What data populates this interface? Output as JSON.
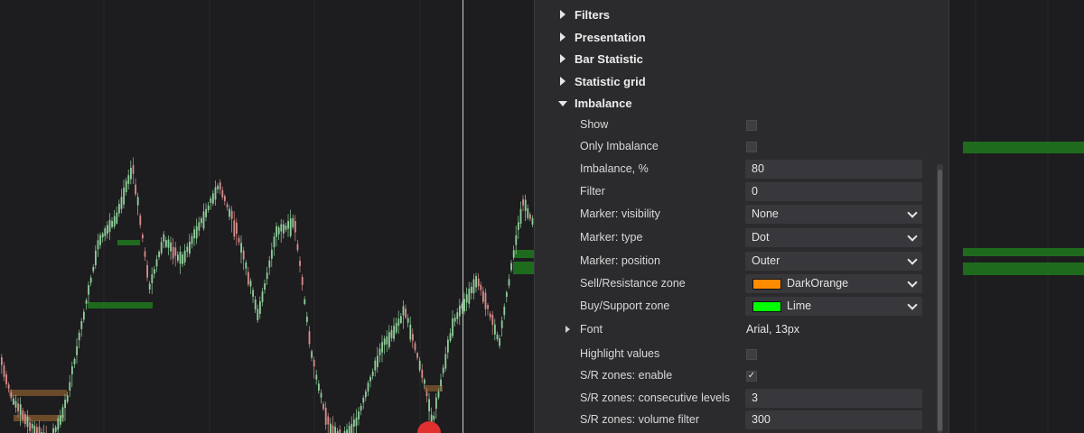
{
  "sections": [
    {
      "label": "Filters",
      "expanded": false
    },
    {
      "label": "Presentation",
      "expanded": false
    },
    {
      "label": "Bar Statistic",
      "expanded": false
    },
    {
      "label": "Statistic grid",
      "expanded": false
    },
    {
      "label": "Imbalance",
      "expanded": true
    }
  ],
  "imbalance": {
    "show": {
      "label": "Show",
      "checked": false
    },
    "only_imbalance": {
      "label": "Only Imbalance",
      "checked": false
    },
    "imbalance_pct": {
      "label": "Imbalance, %",
      "value": "80"
    },
    "filter": {
      "label": "Filter",
      "value": "0"
    },
    "marker_visibility": {
      "label": "Marker: visibility",
      "value": "None"
    },
    "marker_type": {
      "label": "Marker: type",
      "value": "Dot"
    },
    "marker_position": {
      "label": "Marker: position",
      "value": "Outer"
    },
    "sell_zone": {
      "label": "Sell/Resistance zone",
      "value": "DarkOrange",
      "color": "#ff8c00"
    },
    "buy_zone": {
      "label": "Buy/Support zone",
      "value": "Lime",
      "color": "#00ff00"
    },
    "font": {
      "label": "Font",
      "value": "Arial, 13px"
    },
    "highlight_values": {
      "label": "Highlight values",
      "checked": false
    },
    "sr_enable": {
      "label": "S/R zones: enable",
      "checked": true,
      "mark": "✓"
    },
    "sr_consecutive": {
      "label": "S/R zones: consecutive levels",
      "value": "3"
    },
    "sr_volume_filter": {
      "label": "S/R zones: volume filter",
      "value": "300"
    }
  },
  "icons": {
    "collapsed": "triangle-right-icon",
    "expanded": "triangle-down-icon",
    "dropdown": "chevron-down-icon"
  },
  "colors": {
    "background": "#1d1d1f",
    "panel": "#2b2b2e",
    "bull_candle": "#8fcf9a",
    "bear_candle": "#d98b8b",
    "buy_zone_bar": "#1e6b1e",
    "sell_zone_bar": "#6b4a2a"
  }
}
